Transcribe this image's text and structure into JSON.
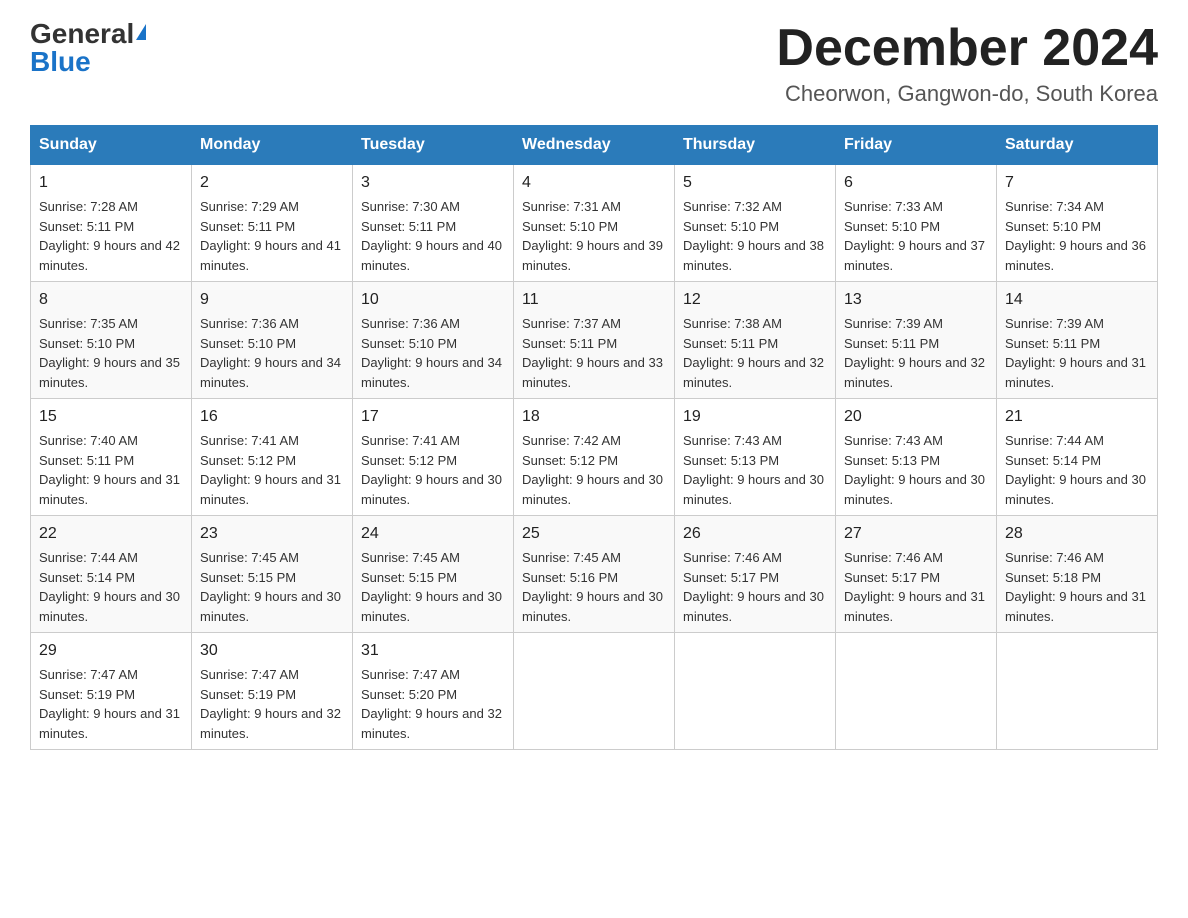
{
  "header": {
    "logo_general": "General",
    "logo_blue": "Blue",
    "month_title": "December 2024",
    "subtitle": "Cheorwon, Gangwon-do, South Korea"
  },
  "weekdays": [
    "Sunday",
    "Monday",
    "Tuesday",
    "Wednesday",
    "Thursday",
    "Friday",
    "Saturday"
  ],
  "weeks": [
    [
      {
        "day": "1",
        "sunrise": "7:28 AM",
        "sunset": "5:11 PM",
        "daylight": "9 hours and 42 minutes."
      },
      {
        "day": "2",
        "sunrise": "7:29 AM",
        "sunset": "5:11 PM",
        "daylight": "9 hours and 41 minutes."
      },
      {
        "day": "3",
        "sunrise": "7:30 AM",
        "sunset": "5:11 PM",
        "daylight": "9 hours and 40 minutes."
      },
      {
        "day": "4",
        "sunrise": "7:31 AM",
        "sunset": "5:10 PM",
        "daylight": "9 hours and 39 minutes."
      },
      {
        "day": "5",
        "sunrise": "7:32 AM",
        "sunset": "5:10 PM",
        "daylight": "9 hours and 38 minutes."
      },
      {
        "day": "6",
        "sunrise": "7:33 AM",
        "sunset": "5:10 PM",
        "daylight": "9 hours and 37 minutes."
      },
      {
        "day": "7",
        "sunrise": "7:34 AM",
        "sunset": "5:10 PM",
        "daylight": "9 hours and 36 minutes."
      }
    ],
    [
      {
        "day": "8",
        "sunrise": "7:35 AM",
        "sunset": "5:10 PM",
        "daylight": "9 hours and 35 minutes."
      },
      {
        "day": "9",
        "sunrise": "7:36 AM",
        "sunset": "5:10 PM",
        "daylight": "9 hours and 34 minutes."
      },
      {
        "day": "10",
        "sunrise": "7:36 AM",
        "sunset": "5:10 PM",
        "daylight": "9 hours and 34 minutes."
      },
      {
        "day": "11",
        "sunrise": "7:37 AM",
        "sunset": "5:11 PM",
        "daylight": "9 hours and 33 minutes."
      },
      {
        "day": "12",
        "sunrise": "7:38 AM",
        "sunset": "5:11 PM",
        "daylight": "9 hours and 32 minutes."
      },
      {
        "day": "13",
        "sunrise": "7:39 AM",
        "sunset": "5:11 PM",
        "daylight": "9 hours and 32 minutes."
      },
      {
        "day": "14",
        "sunrise": "7:39 AM",
        "sunset": "5:11 PM",
        "daylight": "9 hours and 31 minutes."
      }
    ],
    [
      {
        "day": "15",
        "sunrise": "7:40 AM",
        "sunset": "5:11 PM",
        "daylight": "9 hours and 31 minutes."
      },
      {
        "day": "16",
        "sunrise": "7:41 AM",
        "sunset": "5:12 PM",
        "daylight": "9 hours and 31 minutes."
      },
      {
        "day": "17",
        "sunrise": "7:41 AM",
        "sunset": "5:12 PM",
        "daylight": "9 hours and 30 minutes."
      },
      {
        "day": "18",
        "sunrise": "7:42 AM",
        "sunset": "5:12 PM",
        "daylight": "9 hours and 30 minutes."
      },
      {
        "day": "19",
        "sunrise": "7:43 AM",
        "sunset": "5:13 PM",
        "daylight": "9 hours and 30 minutes."
      },
      {
        "day": "20",
        "sunrise": "7:43 AM",
        "sunset": "5:13 PM",
        "daylight": "9 hours and 30 minutes."
      },
      {
        "day": "21",
        "sunrise": "7:44 AM",
        "sunset": "5:14 PM",
        "daylight": "9 hours and 30 minutes."
      }
    ],
    [
      {
        "day": "22",
        "sunrise": "7:44 AM",
        "sunset": "5:14 PM",
        "daylight": "9 hours and 30 minutes."
      },
      {
        "day": "23",
        "sunrise": "7:45 AM",
        "sunset": "5:15 PM",
        "daylight": "9 hours and 30 minutes."
      },
      {
        "day": "24",
        "sunrise": "7:45 AM",
        "sunset": "5:15 PM",
        "daylight": "9 hours and 30 minutes."
      },
      {
        "day": "25",
        "sunrise": "7:45 AM",
        "sunset": "5:16 PM",
        "daylight": "9 hours and 30 minutes."
      },
      {
        "day": "26",
        "sunrise": "7:46 AM",
        "sunset": "5:17 PM",
        "daylight": "9 hours and 30 minutes."
      },
      {
        "day": "27",
        "sunrise": "7:46 AM",
        "sunset": "5:17 PM",
        "daylight": "9 hours and 31 minutes."
      },
      {
        "day": "28",
        "sunrise": "7:46 AM",
        "sunset": "5:18 PM",
        "daylight": "9 hours and 31 minutes."
      }
    ],
    [
      {
        "day": "29",
        "sunrise": "7:47 AM",
        "sunset": "5:19 PM",
        "daylight": "9 hours and 31 minutes."
      },
      {
        "day": "30",
        "sunrise": "7:47 AM",
        "sunset": "5:19 PM",
        "daylight": "9 hours and 32 minutes."
      },
      {
        "day": "31",
        "sunrise": "7:47 AM",
        "sunset": "5:20 PM",
        "daylight": "9 hours and 32 minutes."
      },
      null,
      null,
      null,
      null
    ]
  ]
}
